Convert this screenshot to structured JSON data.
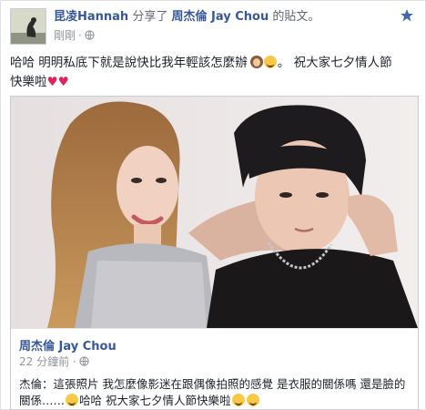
{
  "post": {
    "author": "昆凌Hannah",
    "action": "分享了",
    "shared_from": "周杰倫 Jay Chou",
    "suffix": "的貼文。",
    "time": "剛剛",
    "text_line1": "哈哈 明明私底下就是說快比我年輕該怎麼辦",
    "text_line1_end": "。 祝大家七夕情人節",
    "text_line2": "快樂啦",
    "hearts": "♥♥"
  },
  "shared": {
    "author": "周杰倫 Jay Chou",
    "time": "22 分鐘前 ·",
    "caption_line1": "杰倫：這張照片 我怎麼像影迷在跟偶像拍照的感覺 是衣服的關係嗎 還是臉的關係……",
    "caption_line2": "哈哈 祝大家七夕情人節快樂啦"
  },
  "icons": {
    "star": "star-icon",
    "globe": "globe-icon",
    "avatar": "profile-avatar"
  },
  "colors": {
    "link": "#365899",
    "meta": "#90949c",
    "star": "#4267b2"
  }
}
